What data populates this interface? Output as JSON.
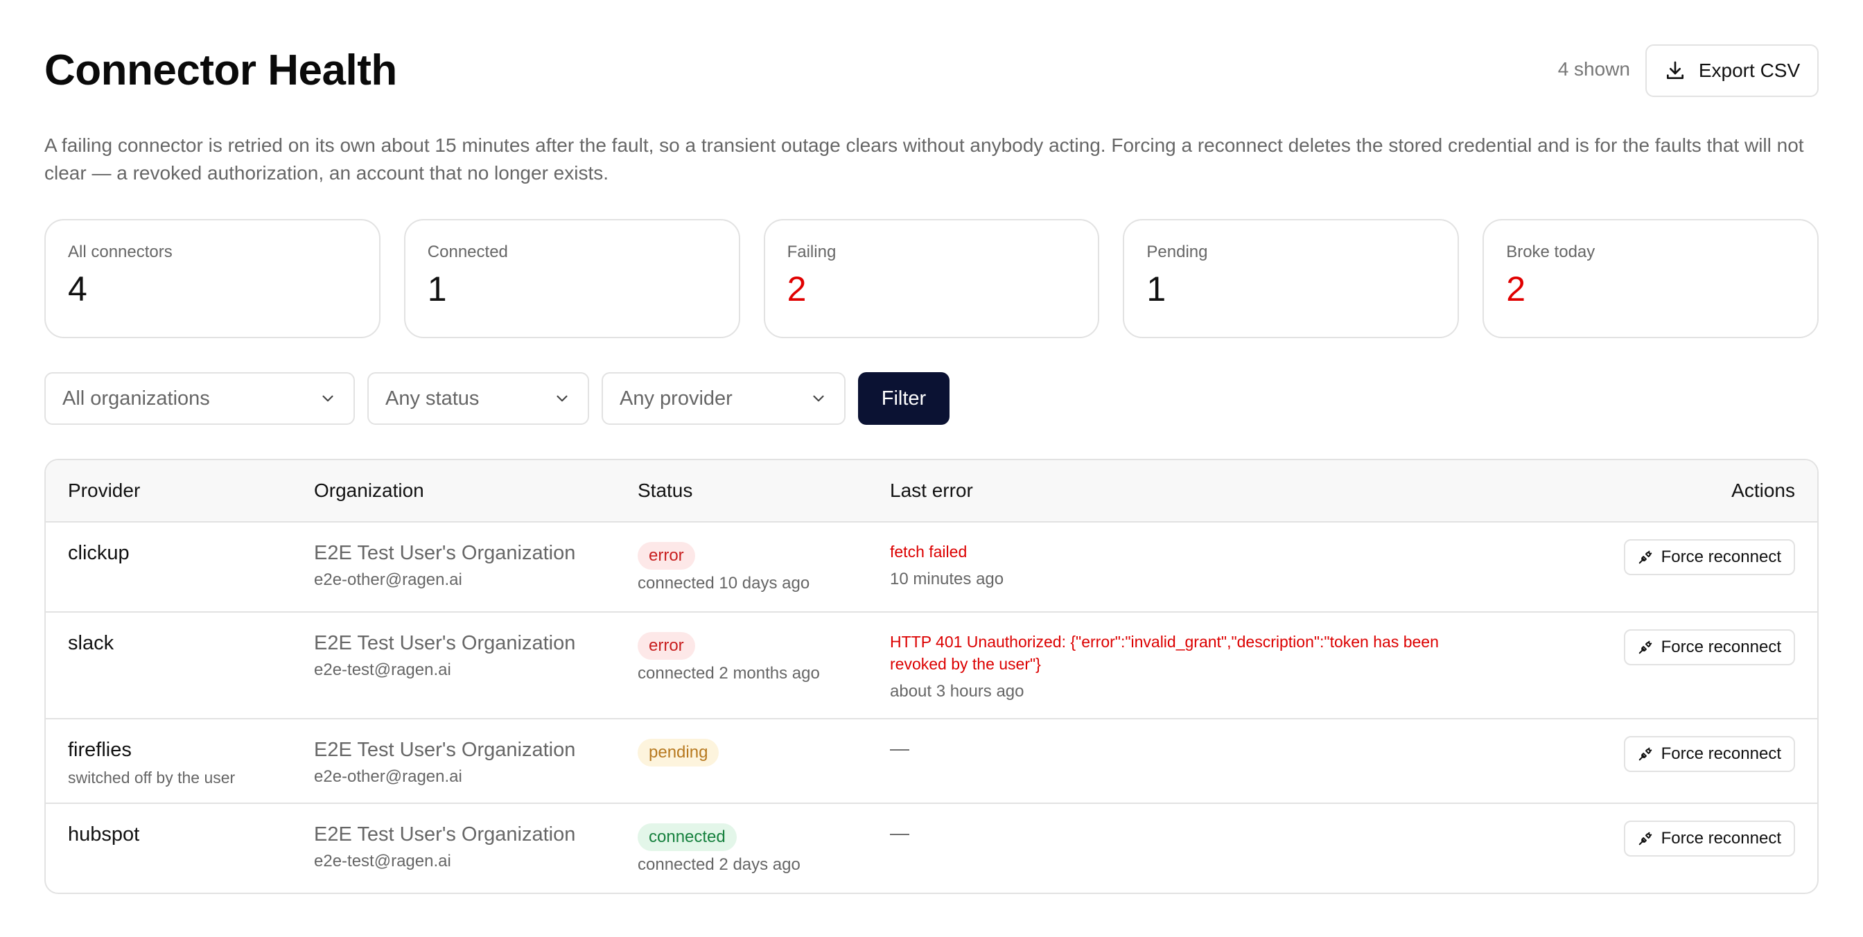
{
  "header": {
    "title": "Connector Health",
    "shown": "4 shown",
    "export_label": "Export CSV"
  },
  "description": "A failing connector is retried on its own about 15 minutes after the fault, so a transient outage clears without anybody acting. Forcing a reconnect deletes the stored credential and is for the faults that will not clear — a revoked authorization, an account that no longer exists.",
  "stats": [
    {
      "label": "All connectors",
      "value": "4"
    },
    {
      "label": "Connected",
      "value": "1"
    },
    {
      "label": "Failing",
      "value": "2"
    },
    {
      "label": "Pending",
      "value": "1"
    },
    {
      "label": "Broke today",
      "value": "2"
    }
  ],
  "filters": {
    "organization": "All organizations",
    "status": "Any status",
    "provider": "Any provider",
    "filter_label": "Filter"
  },
  "table": {
    "columns": {
      "provider": "Provider",
      "organization": "Organization",
      "status": "Status",
      "last_error": "Last error",
      "actions": "Actions"
    },
    "rows": [
      {
        "provider": "clickup",
        "provider_note": "",
        "organization": "E2E Test User's Organization",
        "email": "e2e-other@ragen.ai",
        "status": "error",
        "status_detail": "connected 10 days ago",
        "error": "fetch failed",
        "error_time": "10 minutes ago",
        "action": "Force reconnect"
      },
      {
        "provider": "slack",
        "provider_note": "",
        "organization": "E2E Test User's Organization",
        "email": "e2e-test@ragen.ai",
        "status": "error",
        "status_detail": "connected 2 months ago",
        "error": "HTTP 401 Unauthorized: {\"error\":\"invalid_grant\",\"description\":\"token has been revoked by the user\"}",
        "error_time": "about 3 hours ago",
        "action": "Force reconnect"
      },
      {
        "provider": "fireflies",
        "provider_note": "switched off by the user",
        "organization": "E2E Test User's Organization",
        "email": "e2e-other@ragen.ai",
        "status": "pending",
        "status_detail": "",
        "error": "—",
        "error_time": "",
        "action": "Force reconnect"
      },
      {
        "provider": "hubspot",
        "provider_note": "",
        "organization": "E2E Test User's Organization",
        "email": "e2e-test@ragen.ai",
        "status": "connected",
        "status_detail": "connected 2 days ago",
        "error": "—",
        "error_time": "",
        "action": "Force reconnect"
      }
    ]
  },
  "icons": {
    "export": "download-icon",
    "select": "chevron-down-icon",
    "reconnect": "plug-icon"
  },
  "colors": {
    "filter_button": "#0b1233",
    "error": "#dc0000",
    "error_badge_bg": "#fde8e8",
    "pending_badge_bg": "#fdf4dd",
    "connected_badge_bg": "#e3f6e9"
  }
}
